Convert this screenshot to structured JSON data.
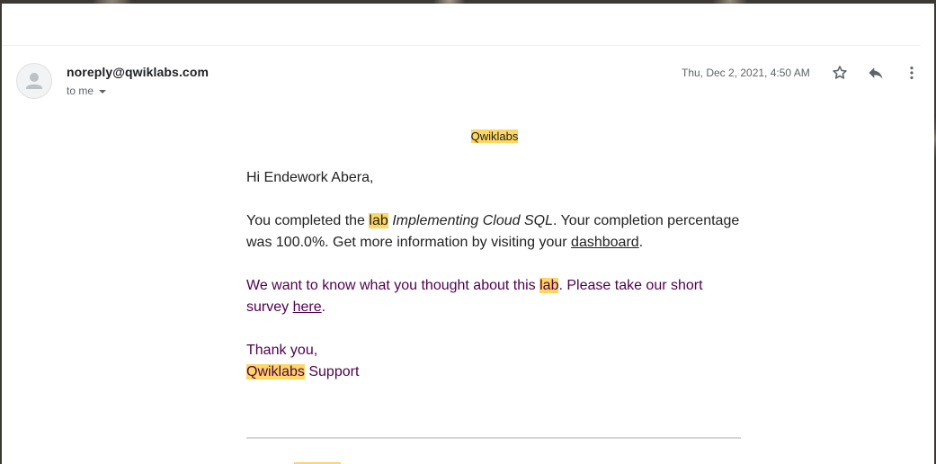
{
  "email": {
    "sender": "noreply@qwiklabs.com",
    "recipient_label": "to me",
    "date": "Thu, Dec 2, 2021, 4:50 AM",
    "actions": {
      "star_icon": "star-outline-icon",
      "reply_icon": "reply-icon",
      "more_icon": "more-vert-icon"
    }
  },
  "body": {
    "brand": "Qwiklabs",
    "greeting": "Hi Endework Abera,",
    "completion": {
      "prefix": "You completed the ",
      "lab_word": "lab",
      "lab_name": "Implementing Cloud SQL",
      "middle": ". Your completion percentage was 100.0%. Get more information by visiting your ",
      "dashboard_link": "dashboard",
      "suffix": "."
    },
    "survey": {
      "prefix": "We want to know what you thought about this ",
      "lab_word": "lab",
      "middle": ". Please take our short survey ",
      "here_link": "here",
      "suffix": "."
    },
    "signoff": {
      "thanks": "Thank you,",
      "brand": "Qwiklabs",
      "team": " Support"
    }
  },
  "colors": {
    "highlight": "#fdd663",
    "quoted_text": "#500050",
    "body_text": "#222222",
    "meta_text": "#5f6368"
  }
}
